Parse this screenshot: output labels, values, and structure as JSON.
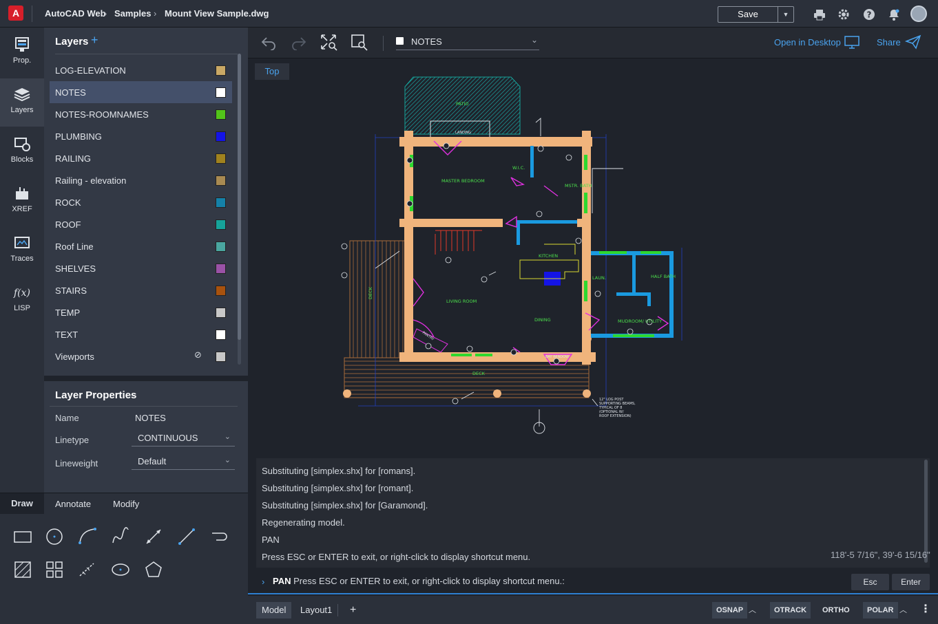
{
  "app": {
    "logo_letter": "A"
  },
  "breadcrumb": [
    "AutoCAD Web",
    "Samples",
    "Mount View Sample.dwg"
  ],
  "header": {
    "save_label": "Save"
  },
  "rail": [
    {
      "label": "Prop.",
      "icon": "properties-icon"
    },
    {
      "label": "Layers",
      "icon": "layers-icon"
    },
    {
      "label": "Blocks",
      "icon": "blocks-icon"
    },
    {
      "label": "XREF",
      "icon": "xref-icon"
    },
    {
      "label": "Traces",
      "icon": "traces-icon"
    },
    {
      "label": "LISP",
      "icon": "lisp-icon"
    }
  ],
  "layers": {
    "title": "Layers",
    "items": [
      {
        "name": "LOG-ELEVATION",
        "color": "#c9a865"
      },
      {
        "name": "NOTES",
        "color": "#ffffff"
      },
      {
        "name": "NOTES-ROOMNAMES",
        "color": "#52c41a"
      },
      {
        "name": "PLUMBING",
        "color": "#1414e6"
      },
      {
        "name": "RAILING",
        "color": "#a0821e"
      },
      {
        "name": "Railing - elevation",
        "color": "#a88a52"
      },
      {
        "name": "ROCK",
        "color": "#1581a8"
      },
      {
        "name": "ROOF",
        "color": "#16a39a"
      },
      {
        "name": "Roof Line",
        "color": "#4aa6a0"
      },
      {
        "name": "SHELVES",
        "color": "#9a52a6"
      },
      {
        "name": "STAIRS",
        "color": "#a8520e"
      },
      {
        "name": "TEMP",
        "color": "#c8c8c8"
      },
      {
        "name": "TEXT",
        "color": "#ffffff"
      },
      {
        "name": "Viewports",
        "color": "#c8c8c8"
      }
    ]
  },
  "layer_properties": {
    "title": "Layer Properties",
    "name_label": "Name",
    "name_value": "NOTES",
    "linetype_label": "Linetype",
    "linetype_value": "CONTINUOUS",
    "lineweight_label": "Lineweight",
    "lineweight_value": "Default"
  },
  "tool_tabs": [
    "Draw",
    "Annotate",
    "Modify"
  ],
  "canvas": {
    "current_layer": "NOTES",
    "open_desktop": "Open in Desktop",
    "share": "Share",
    "view_label": "Top"
  },
  "command_log": [
    "Substituting [simplex.shx] for [romans].",
    "Substituting [simplex.shx] for [romant].",
    "Substituting [simplex.shx] for [Garamond].",
    "Regenerating model.",
    "PAN",
    "Press ESC or ENTER to exit, or right-click to display shortcut menu."
  ],
  "coordinates": "118'-5 7/16\", 39'-6 15/16\"",
  "command_line": {
    "command": "PAN",
    "prompt": "Press ESC or ENTER to exit, or right-click to display shortcut menu.:",
    "esc": "Esc",
    "enter": "Enter"
  },
  "status": {
    "tabs": [
      "Model",
      "Layout1"
    ],
    "osnap": "OSNAP",
    "otrack": "OTRACK",
    "ortho": "ORTHO",
    "polar": "POLAR"
  },
  "drawing_labels": {
    "patio": "PATIO",
    "landing": "LANDING",
    "master_bedroom": "MASTER BEDROOM",
    "wic": "W.I.C.",
    "master_bath": "MSTR. BATH",
    "kitchen": "KITCHEN",
    "living_room": "LIVING ROOM",
    "dining": "DINING",
    "laundry": "LAUN.",
    "half_bath": "HALF BATH",
    "mudroom": "MUDROOM/ UTILITY",
    "deck": "DECK",
    "deck_side": "DECK",
    "bay_window": "BAY WINDOW",
    "pantry": "PANTRY",
    "note1": "12\" LOG POST",
    "note2": "SUPPORTING BEAMS,",
    "note3": "TYPICAL OF 8",
    "note4": "(OPTIONAL W/",
    "note5": "ROOF EXTENSION)"
  }
}
